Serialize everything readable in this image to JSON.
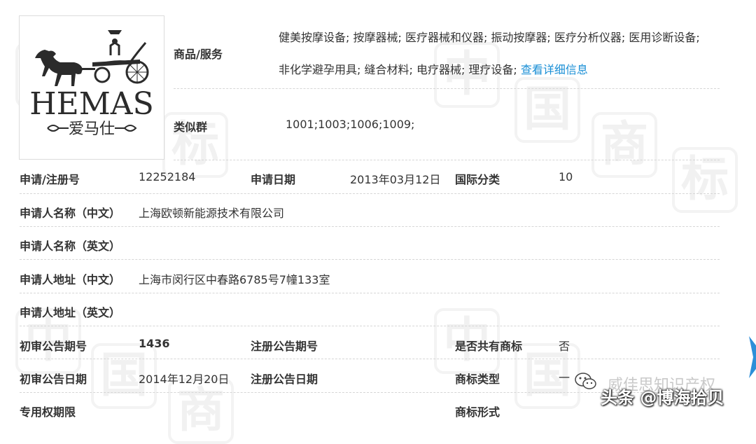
{
  "logo": {
    "brand_en": "HEMAS",
    "brand_cn": "爱马仕"
  },
  "goods": {
    "label": "商品/服务",
    "line1": "健美按摩设备; 按摩器械; 医疗器械和仪器; 振动按摩器; 医疗分析仪器; 医用诊断设备;",
    "line2": "非化学避孕用具; 缝合材料; 电疗器械; 理疗设备;",
    "detail_link": "查看详细信息"
  },
  "similar_group": {
    "label": "类似群",
    "value": "1001;1003;1006;1009;"
  },
  "fields": {
    "reg_no_label": "申请/注册号",
    "reg_no": "12252184",
    "app_date_label": "申请日期",
    "app_date": "2013年03月12日",
    "intl_class_label": "国际分类",
    "intl_class": "10",
    "applicant_cn_label": "申请人名称（中文）",
    "applicant_cn": "上海欧顿新能源技术有限公司",
    "applicant_en_label": "申请人名称（英文）",
    "address_cn_label": "申请人地址（中文）",
    "address_cn": "上海市闵行区中春路6785号7幢133室",
    "address_en_label": "申请人地址（英文）",
    "prelim_no_label": "初审公告期号",
    "prelim_no": "1436",
    "reg_pub_no_label": "注册公告期号",
    "shared_label": "是否共有商标",
    "shared": "否",
    "prelim_date_label": "初审公告日期",
    "prelim_date": "2014年12月20日",
    "reg_pub_date_label": "注册公告日期",
    "tm_type_label": "商标类型",
    "tm_type": "一",
    "exclusive_label": "专用权期限",
    "tm_form_label": "商标形式"
  },
  "overlay": {
    "faded_text": "威佳思知识产权",
    "credit": "头条 @博海拾贝"
  },
  "watermark_chars": [
    "中",
    "国",
    "商",
    "标"
  ],
  "colors": {
    "link": "#1a8fd6",
    "label": "#333333",
    "separator": "#d6d6d6"
  }
}
